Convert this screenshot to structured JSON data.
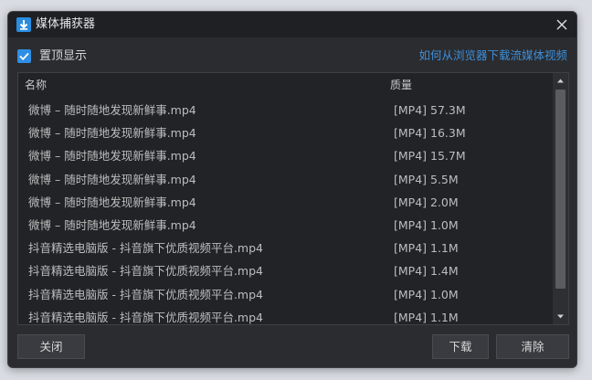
{
  "window": {
    "title": "媒体捕获器",
    "icon": "download-arrow-icon",
    "accent_color": "#2b8de0"
  },
  "options": {
    "pin_on_top_label": "置顶显示",
    "pin_on_top_checked": true,
    "help_link": "如何从浏览器下载流媒体视频"
  },
  "table": {
    "columns": [
      "名称",
      "质量"
    ],
    "rows": [
      {
        "name": "微博 – 随时随地发现新鲜事.mp4",
        "quality": "[MP4] 57.3M"
      },
      {
        "name": "微博 – 随时随地发现新鲜事.mp4",
        "quality": "[MP4] 16.3M"
      },
      {
        "name": "微博 – 随时随地发现新鲜事.mp4",
        "quality": "[MP4] 15.7M"
      },
      {
        "name": "微博 – 随时随地发现新鲜事.mp4",
        "quality": "[MP4] 5.5M"
      },
      {
        "name": "微博 – 随时随地发现新鲜事.mp4",
        "quality": "[MP4] 2.0M"
      },
      {
        "name": "微博 – 随时随地发现新鲜事.mp4",
        "quality": "[MP4] 1.0M"
      },
      {
        "name": "抖音精选电脑版 - 抖音旗下优质视频平台.mp4",
        "quality": "[MP4] 1.1M"
      },
      {
        "name": "抖音精选电脑版 - 抖音旗下优质视频平台.mp4",
        "quality": "[MP4] 1.4M"
      },
      {
        "name": "抖音精选电脑版 - 抖音旗下优质视频平台.mp4",
        "quality": "[MP4] 1.0M"
      },
      {
        "name": "抖音精选电脑版 - 抖音旗下优质视频平台.mp4",
        "quality": "[MP4] 1.1M"
      }
    ]
  },
  "buttons": {
    "close": "关闭",
    "download": "下载",
    "clear": "清除"
  }
}
